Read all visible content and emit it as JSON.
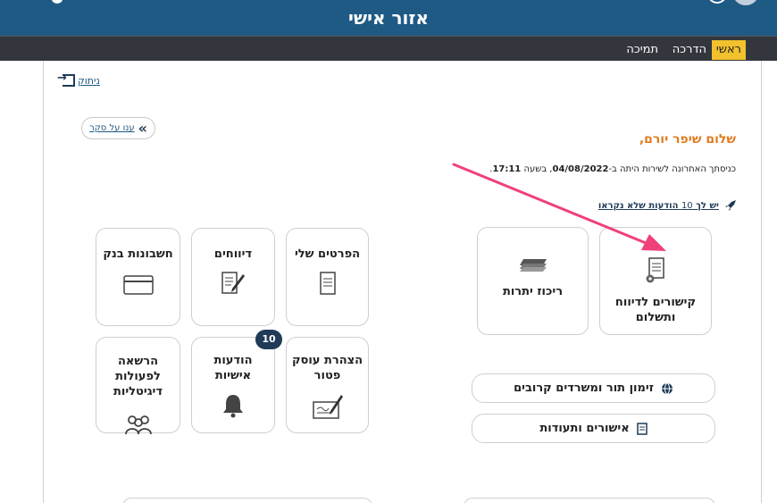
{
  "header": {
    "title": "אזור אישי"
  },
  "nav": {
    "items": [
      {
        "label": "ראשי",
        "active": true
      },
      {
        "label": "הדרכה"
      },
      {
        "label": "תמיכה"
      }
    ]
  },
  "logout": {
    "label": "ניתוק"
  },
  "survey": {
    "label": "ענו על סקר"
  },
  "greeting": "שלום שיפר יורם,",
  "last_login": {
    "prefix": "כניסתך האחרונה לשירות היתה ב-",
    "date": "04/08/2022",
    "middle": ", בשעה ",
    "time": "17:11",
    "suffix": "."
  },
  "unread": {
    "prefix": "יש לך",
    "count": "10",
    "suffix": "הודעות שלא נקראו"
  },
  "tiles": {
    "reporting": {
      "label": "קישורים לדיווח ותשלום"
    },
    "balance": {
      "label": "ריכוז יתרות"
    },
    "my_details": {
      "label": "הפרטים שלי"
    },
    "reports": {
      "label": "דיווחים"
    },
    "bank": {
      "label": "חשבונות בנק"
    },
    "exempt": {
      "label": "הצהרת עוסק פטור"
    },
    "messages": {
      "label": "הודעות אישיות",
      "badge": "10"
    },
    "authorization": {
      "label": "הרשאה לפעולות דיגיטליות"
    }
  },
  "buttons": {
    "appointments": {
      "label": "זימון תור ומשרדים קרובים",
      "icon": "globe-icon"
    },
    "certificates": {
      "label": "אישורים ותעודות",
      "icon": "document-icon"
    }
  },
  "colors": {
    "header": "#1f5a85",
    "nav": "#33373d",
    "active_tab": "#f2c12e",
    "greeting": "#e07b1f",
    "arrow": "#f0407a"
  }
}
